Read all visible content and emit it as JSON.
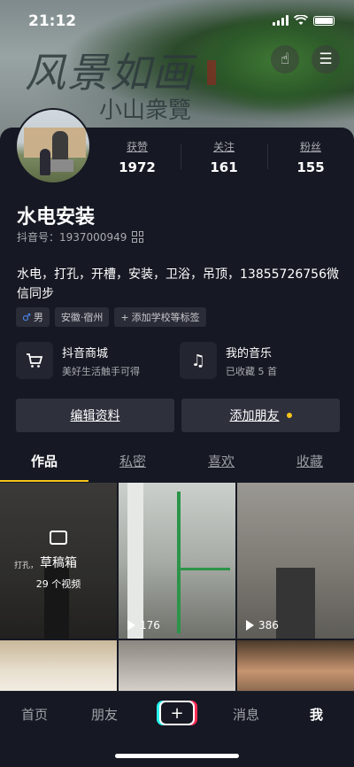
{
  "status_bar": {
    "time": "21:12"
  },
  "banner": {
    "calligraphy_line1": "风景如画",
    "calligraphy_line2": "小山衆覽"
  },
  "header_buttons": {
    "hand_icon": "hand-point-icon",
    "menu_icon": "menu-icon"
  },
  "profile": {
    "name": "水电安装",
    "douyin_id": "抖音号：1937000949",
    "bio": "水电，打孔，开槽，安装，卫浴，吊顶，13855726756微信同步",
    "stats": [
      {
        "label": "获赞",
        "value": "1972"
      },
      {
        "label": "关注",
        "value": "161"
      },
      {
        "label": "粉丝",
        "value": "155"
      }
    ],
    "tags": [
      {
        "icon": "♂",
        "text": "男"
      },
      {
        "text": "安徽·宿州"
      },
      {
        "icon": "+",
        "text": "添加学校等标签"
      }
    ]
  },
  "services": [
    {
      "icon": "cart-icon",
      "title": "抖音商城",
      "subtitle": "美好生活触手可得"
    },
    {
      "icon": "music-icon",
      "title": "我的音乐",
      "subtitle": "已收藏 5 首"
    }
  ],
  "actions": {
    "edit_profile": "编辑资料",
    "add_friend": "添加朋友"
  },
  "tabs": [
    "作品",
    "私密",
    "喜欢",
    "收藏"
  ],
  "grid": {
    "draft": {
      "title": "草稿箱",
      "count": "29 个视频",
      "small_text": "打孔，"
    },
    "videos": [
      {
        "plays": "176"
      },
      {
        "plays": "386"
      }
    ]
  },
  "bottom_nav": {
    "home": "首页",
    "friends": "朋友",
    "plus": "+",
    "messages": "消息",
    "me": "我"
  },
  "colors": {
    "background": "#161823",
    "accent": "#f7c41b",
    "male": "#4c8df6"
  }
}
